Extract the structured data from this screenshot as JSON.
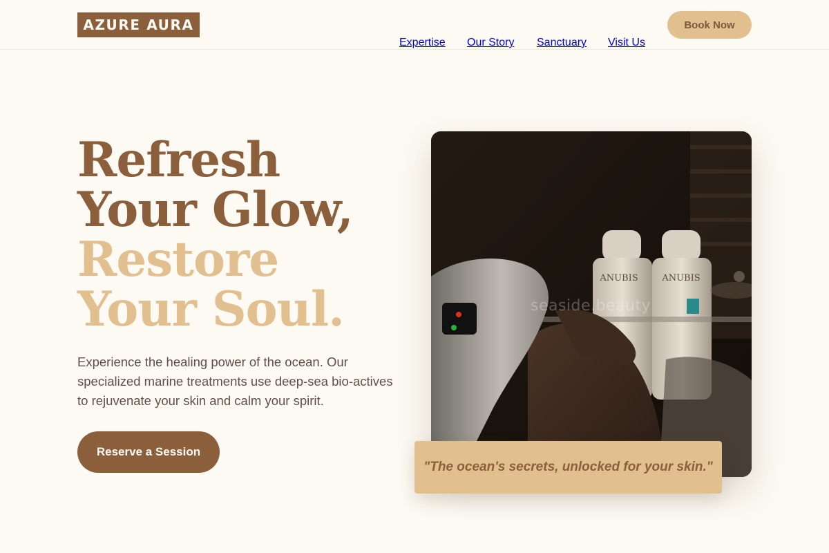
{
  "brand": {
    "logo_text": "AZURE AURA"
  },
  "nav": {
    "items": [
      {
        "label": "Expertise"
      },
      {
        "label": "Our Story"
      },
      {
        "label": "Sanctuary"
      },
      {
        "label": "Visit Us"
      }
    ],
    "cta_label": "Book Now"
  },
  "hero": {
    "headline_line1": "Refresh Your Glow,",
    "headline_line2": "Restore Your Soul.",
    "description": "Experience the healing power of the ocean. Our specialized marine treatments use deep-sea bio-actives to rejuvenate your skin and calm your spirit.",
    "cta_label": "Reserve a Session"
  },
  "photo": {
    "watermark": "seaside.beauty",
    "bottle_label": "ANUBIS",
    "quote": "\"The ocean's secrets, unlocked for your skin.\""
  },
  "colors": {
    "background": "#fdfaf3",
    "brand_brown": "#8b5e3c",
    "accent_gold": "#e2bf8e"
  }
}
